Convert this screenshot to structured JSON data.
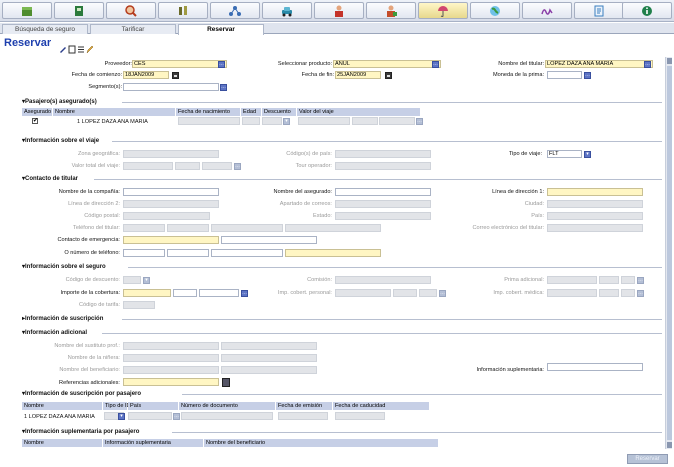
{
  "toolbar": {
    "items": [
      {
        "icon": "box-icon",
        "color": "#4f8d2f"
      },
      {
        "icon": "notebook-icon",
        "color": "#2b7a3c"
      },
      {
        "icon": "magnifier-icon",
        "color": "#b53d1e"
      },
      {
        "icon": "tools-icon",
        "color": "#6b6b2a"
      },
      {
        "icon": "network-icon",
        "color": "#3a6db4"
      },
      {
        "icon": "car-icon",
        "color": "#2a8aa8"
      },
      {
        "icon": "person-red-icon",
        "color": "#c4332a"
      },
      {
        "icon": "person-green-icon",
        "color": "#c44d2a"
      },
      {
        "icon": "umbrella-icon",
        "color": "#d1456f"
      },
      {
        "icon": "globe-icon",
        "color": "#3c9a3c"
      },
      {
        "icon": "signature-icon",
        "color": "#8a3fa8"
      },
      {
        "icon": "document-icon",
        "color": "#3a7fbf"
      },
      {
        "icon": "info-icon",
        "color": "#1f7f4a"
      }
    ],
    "active_index": 8
  },
  "tabs": [
    "Búsqueda de seguro",
    "Tarificar",
    "Reservar"
  ],
  "page_title": "Reservar",
  "header": {
    "proveedor_label": "Proveedor:",
    "proveedor_value": "CES",
    "producto_label": "Seleccionar producto:",
    "producto_value": "ANUL",
    "titular_label": "Nombre del titular:",
    "titular_value": "LOPEZ DAZA ANA MARIA",
    "inicio_label": "Fecha de comienzo:",
    "inicio_value": "18JAN2009",
    "fin_label": "Fecha de fin:",
    "fin_value": "25JAN2009",
    "moneda_label": "Moneda de la prima:",
    "segmentos_label": "Segmento(s):"
  },
  "pasajeros": {
    "title": "Pasajero(s) asegurado(s)",
    "columns": [
      "Asegurado",
      "Nombre",
      "Fecha de nacimiento",
      "Edad",
      "Descuento",
      "Valor del viaje"
    ],
    "rows": [
      {
        "check": "✔",
        "name": "1 LOPEZ DAZA ANA MARIA"
      }
    ]
  },
  "viaje": {
    "title": "Información sobre el viaje",
    "zona": "Zona geográfica:",
    "codigo_pais": "Código(s) de país:",
    "tipo_label": "Tipo de viaje:",
    "tipo_value": "FLT",
    "valor_total": "Valor total del viaje:",
    "tour": "Tour operador:"
  },
  "contacto": {
    "title": "Contacto de titular",
    "compania": "Nombre de la compañía:",
    "asegurado": "Nombre del asegurado:",
    "linea1": "Línea de dirección 1:",
    "linea2": "Línea de dirección 2:",
    "apartado": "Apartado de correos:",
    "ciudad": "Ciudad:",
    "postal": "Código postal:",
    "estado": "Estado:",
    "pais": "País:",
    "telefono": "Teléfono del titular:",
    "correo": "Correo electrónico del titular:",
    "emergencia": "Contacto de emergencia:",
    "numero": "O número de teléfono:"
  },
  "seguro": {
    "title": "Información sobre el seguro",
    "descuento": "Código de descuento:",
    "comision": "Comisión:",
    "prima": "Prima adicional:",
    "cobertura": "Importe de la cobertura:",
    "personal": "Imp. cobert. personal:",
    "medica": "Imp. cobert. médica:",
    "tarifa": "Código de tarifa:"
  },
  "suscripcion_title": "Información de suscripción",
  "adicional": {
    "title": "Información adicional",
    "sustituto": "Nombre del sustituto prof.:",
    "ninera": "Nombre de la niñera:",
    "beneficiario": "Nombre del beneficiario:",
    "suplementaria": "Información suplementaria:",
    "referencias": "Referencias adicionales:"
  },
  "susc_pasajero": {
    "title": "Información de suscripción por pasajero",
    "columns": [
      "Nombre",
      "Tipo de ID",
      "País",
      "Número de documento",
      "Fecha de emisión",
      "Fecha de caducidad"
    ],
    "row_name": "1 LOPEZ DAZA ANA MARIA"
  },
  "supl_pasajero": {
    "title": "Información suplementaria por pasajero",
    "columns": [
      "Nombre",
      "Información suplementaria",
      "Nombre del beneficiario"
    ]
  },
  "save_label": "Reservar"
}
